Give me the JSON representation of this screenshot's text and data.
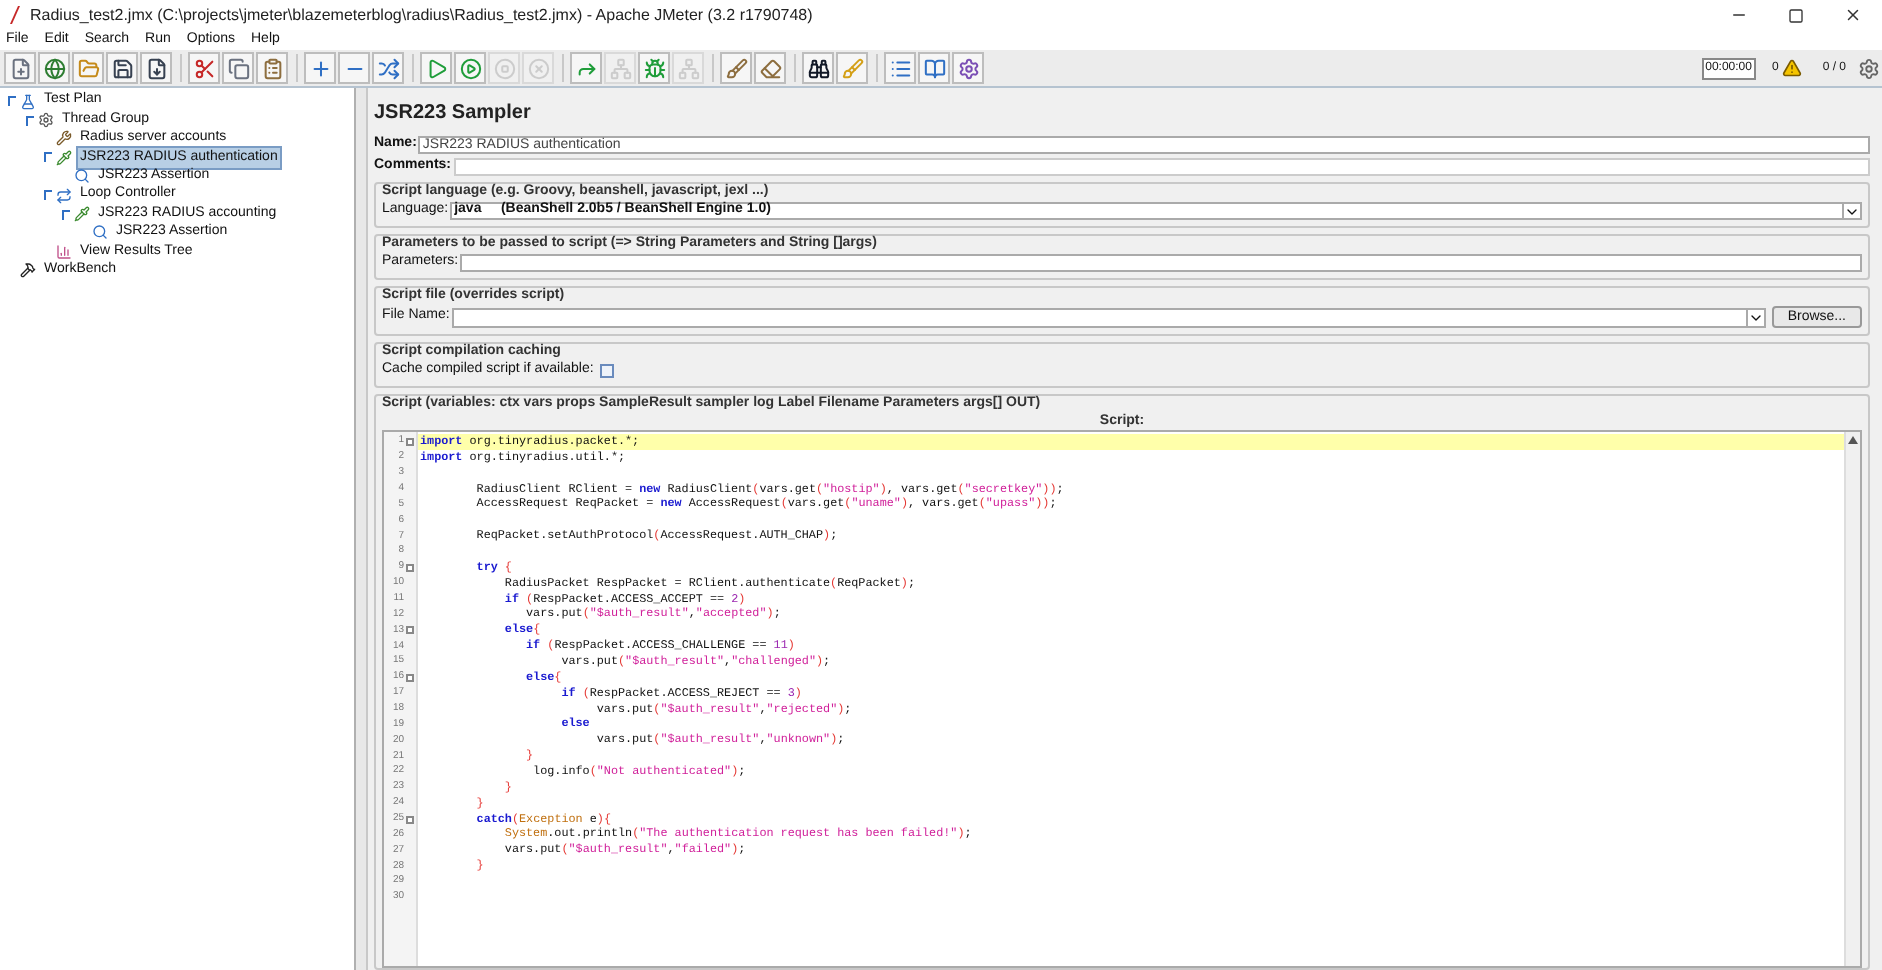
{
  "window": {
    "title": "Radius_test2.jmx (C:\\projects\\jmeter\\blazemeterblog\\radius\\Radius_test2.jmx) - Apache JMeter (3.2 r1790748)"
  },
  "menu": [
    "File",
    "Edit",
    "Search",
    "Run",
    "Options",
    "Help"
  ],
  "toolbar": [
    {
      "kind": "new",
      "disabled": false
    },
    {
      "kind": "templates",
      "disabled": false
    },
    {
      "kind": "open",
      "disabled": false
    },
    {
      "kind": "save",
      "disabled": false
    },
    {
      "kind": "saveas",
      "disabled": false
    },
    {
      "kind": "sep"
    },
    {
      "kind": "cut",
      "disabled": false
    },
    {
      "kind": "copy",
      "disabled": false
    },
    {
      "kind": "paste",
      "disabled": false
    },
    {
      "kind": "sep"
    },
    {
      "kind": "expand",
      "disabled": false
    },
    {
      "kind": "collapse",
      "disabled": false
    },
    {
      "kind": "toggle",
      "disabled": false
    },
    {
      "kind": "sep"
    },
    {
      "kind": "start",
      "disabled": false
    },
    {
      "kind": "startnopause",
      "disabled": false
    },
    {
      "kind": "stop",
      "disabled": true
    },
    {
      "kind": "shutdown",
      "disabled": true
    },
    {
      "kind": "sep"
    },
    {
      "kind": "remotestart",
      "disabled": false
    },
    {
      "kind": "remotestop",
      "disabled": true
    },
    {
      "kind": "remotebug",
      "disabled": false
    },
    {
      "kind": "remoteexit",
      "disabled": true
    },
    {
      "kind": "sep"
    },
    {
      "kind": "clear",
      "disabled": false
    },
    {
      "kind": "clearall",
      "disabled": false
    },
    {
      "kind": "sep"
    },
    {
      "kind": "search",
      "disabled": false
    },
    {
      "kind": "reset",
      "disabled": false
    },
    {
      "kind": "sep"
    },
    {
      "kind": "functions",
      "disabled": false
    },
    {
      "kind": "help",
      "disabled": false
    },
    {
      "kind": "remote",
      "disabled": false
    }
  ],
  "status": {
    "timer": "00:00:00",
    "warnings": "0",
    "threads": "0 / 0"
  },
  "tree": [
    {
      "label": "Test Plan",
      "kind": "plan",
      "expanded": true,
      "selected": false,
      "children": [
        {
          "label": "Thread Group",
          "kind": "gear",
          "expanded": true,
          "selected": false,
          "children": [
            {
              "label": "Radius server accounts",
              "kind": "tools",
              "selected": false
            },
            {
              "label": "JSR223 RADIUS authentication",
              "kind": "pipette",
              "expanded": true,
              "selected": true,
              "children": [
                {
                  "label": "JSR223 Assertion",
                  "kind": "magnifier",
                  "selected": false
                }
              ]
            },
            {
              "label": "Loop Controller",
              "kind": "loop",
              "expanded": true,
              "selected": false,
              "children": [
                {
                  "label": "JSR223 RADIUS accounting",
                  "kind": "pipette",
                  "expanded": true,
                  "selected": false,
                  "children": [
                    {
                      "label": "JSR223 Assertion",
                      "kind": "magnifier",
                      "selected": false
                    }
                  ]
                }
              ]
            },
            {
              "label": "View Results Tree",
              "kind": "chart",
              "selected": false
            }
          ]
        }
      ]
    },
    {
      "label": "WorkBench",
      "kind": "bench",
      "selected": false
    }
  ],
  "panel": {
    "heading": "JSR223 Sampler",
    "name_label": "Name:",
    "name_value": "JSR223 RADIUS authentication",
    "comments_label": "Comments:",
    "lang_group": "Script language (e.g. Groovy, beanshell, javascript, jexl ...)",
    "lang_label": "Language:",
    "lang_value": "java     (BeanShell 2.0b5 / BeanShell Engine 1.0)",
    "params_group": "Parameters to be passed to script (=> String Parameters and String []args)",
    "params_label": "Parameters:",
    "file_group": "Script file (overrides script)",
    "file_label": "File Name:",
    "browse": "Browse...",
    "cache_group": "Script compilation caching",
    "cache_label": "Cache compiled script if available:",
    "cache_checked": false,
    "script_group": "Script (variables: ctx vars props SampleResult sampler log Label Filename Parameters args[] OUT)",
    "script_header": "Script:"
  },
  "code": [
    {
      "number": "1",
      "fold": true,
      "current": true,
      "tokens": [
        {
          "kind": "k",
          "text": "import"
        },
        {
          "kind": "p",
          "text": " org.tinyradius.packet.*;"
        }
      ]
    },
    {
      "number": "2",
      "fold": false,
      "current": false,
      "tokens": [
        {
          "kind": "k",
          "text": "import"
        },
        {
          "kind": "p",
          "text": " org.tinyradius.util.*;"
        }
      ]
    },
    {
      "number": "3",
      "fold": false,
      "current": false
    },
    {
      "number": "4",
      "fold": false,
      "current": false,
      "tokens": [
        {
          "kind": "p",
          "text": "        RadiusClient RClient = "
        },
        {
          "kind": "k",
          "text": "new"
        },
        {
          "kind": "p",
          "text": " RadiusClient"
        },
        {
          "kind": "b",
          "text": "("
        },
        {
          "kind": "p",
          "text": "vars.get"
        },
        {
          "kind": "b",
          "text": "("
        },
        {
          "kind": "s",
          "text": "\"hostip\""
        },
        {
          "kind": "b",
          "text": ")"
        },
        {
          "kind": "p",
          "text": ", vars.get"
        },
        {
          "kind": "b",
          "text": "("
        },
        {
          "kind": "s",
          "text": "\"secretkey\""
        },
        {
          "kind": "b",
          "text": "))"
        },
        {
          "kind": "p",
          "text": ";"
        }
      ]
    },
    {
      "number": "5",
      "fold": false,
      "current": false,
      "tokens": [
        {
          "kind": "p",
          "text": "        AccessRequest ReqPacket = "
        },
        {
          "kind": "k",
          "text": "new"
        },
        {
          "kind": "p",
          "text": " AccessRequest"
        },
        {
          "kind": "b",
          "text": "("
        },
        {
          "kind": "p",
          "text": "vars.get"
        },
        {
          "kind": "b",
          "text": "("
        },
        {
          "kind": "s",
          "text": "\"uname\""
        },
        {
          "kind": "b",
          "text": ")"
        },
        {
          "kind": "p",
          "text": ", vars.get"
        },
        {
          "kind": "b",
          "text": "("
        },
        {
          "kind": "s",
          "text": "\"upass\""
        },
        {
          "kind": "b",
          "text": "))"
        },
        {
          "kind": "p",
          "text": ";"
        }
      ]
    },
    {
      "number": "6",
      "fold": false,
      "current": false
    },
    {
      "number": "7",
      "fold": false,
      "current": false,
      "tokens": [
        {
          "kind": "p",
          "text": "        ReqPacket.setAuthProtocol"
        },
        {
          "kind": "b",
          "text": "("
        },
        {
          "kind": "p",
          "text": "AccessRequest.AUTH_CHAP"
        },
        {
          "kind": "b",
          "text": ")"
        },
        {
          "kind": "p",
          "text": ";"
        }
      ]
    },
    {
      "number": "8",
      "fold": false,
      "current": false
    },
    {
      "number": "9",
      "fold": true,
      "current": false,
      "tokens": [
        {
          "kind": "k",
          "text": "        try "
        },
        {
          "kind": "b",
          "text": "{"
        }
      ]
    },
    {
      "number": "10",
      "fold": false,
      "current": false,
      "tokens": [
        {
          "kind": "p",
          "text": "            RadiusPacket RespPacket = RClient.authenticate"
        },
        {
          "kind": "b",
          "text": "("
        },
        {
          "kind": "p",
          "text": "ReqPacket"
        },
        {
          "kind": "b",
          "text": ")"
        },
        {
          "kind": "p",
          "text": ";"
        }
      ]
    },
    {
      "number": "11",
      "fold": false,
      "current": false,
      "tokens": [
        {
          "kind": "k",
          "text": "            if "
        },
        {
          "kind": "b",
          "text": "("
        },
        {
          "kind": "p",
          "text": "RespPacket.ACCESS_ACCEPT == "
        },
        {
          "kind": "n",
          "text": "2"
        },
        {
          "kind": "b",
          "text": ")"
        }
      ]
    },
    {
      "number": "12",
      "fold": false,
      "current": false,
      "tokens": [
        {
          "kind": "p",
          "text": "               vars.put"
        },
        {
          "kind": "b",
          "text": "("
        },
        {
          "kind": "s",
          "text": "\"$auth_result\""
        },
        {
          "kind": "p",
          "text": ","
        },
        {
          "kind": "s",
          "text": "\"accepted\""
        },
        {
          "kind": "b",
          "text": ")"
        },
        {
          "kind": "p",
          "text": ";"
        }
      ]
    },
    {
      "number": "13",
      "fold": true,
      "current": false,
      "tokens": [
        {
          "kind": "k",
          "text": "            else"
        },
        {
          "kind": "b",
          "text": "{"
        }
      ]
    },
    {
      "number": "14",
      "fold": false,
      "current": false,
      "tokens": [
        {
          "kind": "k",
          "text": "               if "
        },
        {
          "kind": "b",
          "text": "("
        },
        {
          "kind": "p",
          "text": "RespPacket.ACCESS_CHALLENGE == "
        },
        {
          "kind": "n",
          "text": "11"
        },
        {
          "kind": "b",
          "text": ")"
        }
      ]
    },
    {
      "number": "15",
      "fold": false,
      "current": false,
      "tokens": [
        {
          "kind": "p",
          "text": "                    vars.put"
        },
        {
          "kind": "b",
          "text": "("
        },
        {
          "kind": "s",
          "text": "\"$auth_result\""
        },
        {
          "kind": "p",
          "text": ","
        },
        {
          "kind": "s",
          "text": "\"challenged\""
        },
        {
          "kind": "b",
          "text": ")"
        },
        {
          "kind": "p",
          "text": ";"
        }
      ]
    },
    {
      "number": "16",
      "fold": true,
      "current": false,
      "tokens": [
        {
          "kind": "k",
          "text": "               else"
        },
        {
          "kind": "b",
          "text": "{"
        }
      ]
    },
    {
      "number": "17",
      "fold": false,
      "current": false,
      "tokens": [
        {
          "kind": "k",
          "text": "                    if "
        },
        {
          "kind": "b",
          "text": "("
        },
        {
          "kind": "p",
          "text": "RespPacket.ACCESS_REJECT == "
        },
        {
          "kind": "n",
          "text": "3"
        },
        {
          "kind": "b",
          "text": ")"
        }
      ]
    },
    {
      "number": "18",
      "fold": false,
      "current": false,
      "tokens": [
        {
          "kind": "p",
          "text": "                         vars.put"
        },
        {
          "kind": "b",
          "text": "("
        },
        {
          "kind": "s",
          "text": "\"$auth_result\""
        },
        {
          "kind": "p",
          "text": ","
        },
        {
          "kind": "s",
          "text": "\"rejected\""
        },
        {
          "kind": "b",
          "text": ")"
        },
        {
          "kind": "p",
          "text": ";"
        }
      ]
    },
    {
      "number": "19",
      "fold": false,
      "current": false,
      "tokens": [
        {
          "kind": "k",
          "text": "                    else"
        }
      ]
    },
    {
      "number": "20",
      "fold": false,
      "current": false,
      "tokens": [
        {
          "kind": "p",
          "text": "                         vars.put"
        },
        {
          "kind": "b",
          "text": "("
        },
        {
          "kind": "s",
          "text": "\"$auth_result\""
        },
        {
          "kind": "p",
          "text": ","
        },
        {
          "kind": "s",
          "text": "\"unknown\""
        },
        {
          "kind": "b",
          "text": ")"
        },
        {
          "kind": "p",
          "text": ";"
        }
      ]
    },
    {
      "number": "21",
      "fold": false,
      "current": false,
      "tokens": [
        {
          "kind": "b",
          "text": "               }"
        }
      ]
    },
    {
      "number": "22",
      "fold": false,
      "current": false,
      "tokens": [
        {
          "kind": "p",
          "text": "                log.info"
        },
        {
          "kind": "b",
          "text": "("
        },
        {
          "kind": "s",
          "text": "\"Not authenticated\""
        },
        {
          "kind": "b",
          "text": ")"
        },
        {
          "kind": "p",
          "text": ";"
        }
      ]
    },
    {
      "number": "23",
      "fold": false,
      "current": false,
      "tokens": [
        {
          "kind": "b",
          "text": "            }"
        }
      ]
    },
    {
      "number": "24",
      "fold": false,
      "current": false,
      "tokens": [
        {
          "kind": "b",
          "text": "        }"
        }
      ]
    },
    {
      "number": "25",
      "fold": true,
      "current": false,
      "tokens": [
        {
          "kind": "k",
          "text": "        catch"
        },
        {
          "kind": "b",
          "text": "("
        },
        {
          "kind": "t",
          "text": "Exception"
        },
        {
          "kind": "p",
          "text": " e"
        },
        {
          "kind": "b",
          "text": "){"
        }
      ]
    },
    {
      "number": "26",
      "fold": false,
      "current": false,
      "tokens": [
        {
          "kind": "t",
          "text": "            System"
        },
        {
          "kind": "p",
          "text": ".out.println"
        },
        {
          "kind": "b",
          "text": "("
        },
        {
          "kind": "s",
          "text": "\"The authentication request has been failed!\""
        },
        {
          "kind": "b",
          "text": ")"
        },
        {
          "kind": "p",
          "text": ";"
        }
      ]
    },
    {
      "number": "27",
      "fold": false,
      "current": false,
      "tokens": [
        {
          "kind": "p",
          "text": "            vars.put"
        },
        {
          "kind": "b",
          "text": "("
        },
        {
          "kind": "s",
          "text": "\"$auth_result\""
        },
        {
          "kind": "p",
          "text": ","
        },
        {
          "kind": "s",
          "text": "\"failed\""
        },
        {
          "kind": "b",
          "text": ")"
        },
        {
          "kind": "p",
          "text": ";"
        }
      ]
    },
    {
      "number": "28",
      "fold": false,
      "current": false,
      "tokens": [
        {
          "kind": "b",
          "text": "        }"
        }
      ]
    },
    {
      "number": "29",
      "fold": false,
      "current": false
    },
    {
      "number": "30",
      "fold": false,
      "current": false
    }
  ]
}
